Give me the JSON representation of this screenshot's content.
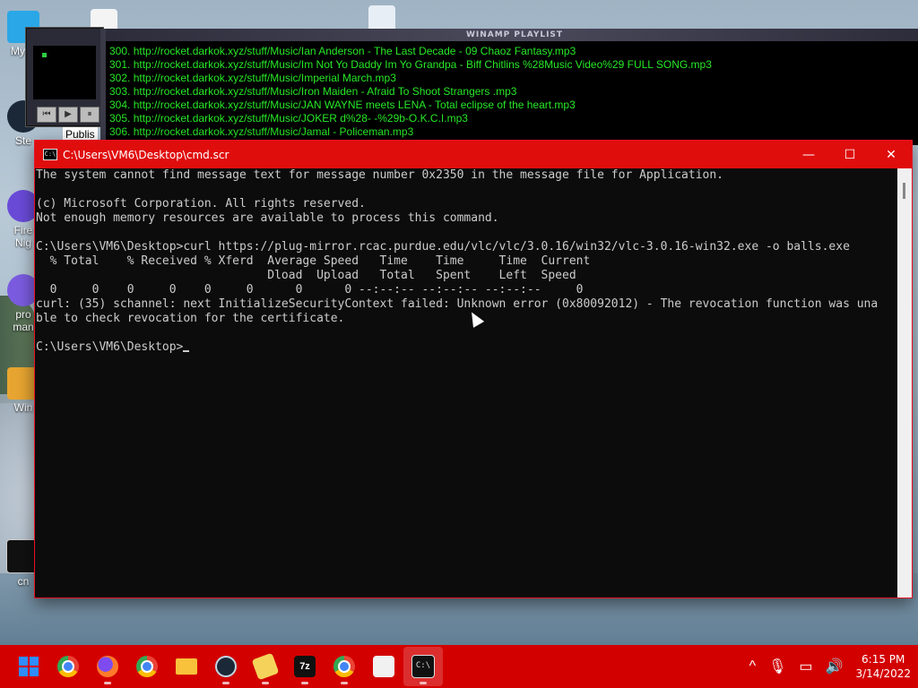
{
  "desktop": {
    "icons": [
      {
        "label": "My C"
      },
      {
        "label": "Ste"
      },
      {
        "label": "Fire\nNig"
      },
      {
        "label": "pro\nman"
      },
      {
        "label": "Win"
      },
      {
        "label": "cn"
      }
    ],
    "publis_label": "Publis"
  },
  "winamp": {
    "playlist_title": "WINAMP PLAYLIST",
    "tracks": [
      "300. http://rocket.darkok.xyz/stuff/Music/Ian Anderson - The Last Decade - 09 Chaoz Fantasy.mp3",
      "301. http://rocket.darkok.xyz/stuff/Music/Im Not Yo Daddy Im Yo Grandpa - Biff Chitlins %28Music Video%29 FULL SONG.mp3",
      "302. http://rocket.darkok.xyz/stuff/Music/Imperial March.mp3",
      "303. http://rocket.darkok.xyz/stuff/Music/Iron Maiden - Afraid To Shoot Strangers .mp3",
      "304. http://rocket.darkok.xyz/stuff/Music/JAN WAYNE meets LENA - Total eclipse of the heart.mp3",
      "305. http://rocket.darkok.xyz/stuff/Music/JOKER d%28- -%29b-O.K.C.I.mp3",
      "306. http://rocket.darkok.xyz/stuff/Music/Jamal - Policeman.mp3"
    ]
  },
  "cmd": {
    "title": "C:\\Users\\VM6\\Desktop\\cmd.scr",
    "icon_text": "C:\\",
    "lines": [
      "The system cannot find message text for message number 0x2350 in the message file for Application.",
      "",
      "(c) Microsoft Corporation. All rights reserved.",
      "Not enough memory resources are available to process this command.",
      "",
      "C:\\Users\\VM6\\Desktop>curl https://plug-mirror.rcac.purdue.edu/vlc/vlc/3.0.16/win32/vlc-3.0.16-win32.exe -o balls.exe",
      "  % Total    % Received % Xferd  Average Speed   Time    Time     Time  Current",
      "                                 Dload  Upload   Total   Spent    Left  Speed",
      "  0     0    0     0    0     0      0      0 --:--:-- --:--:-- --:--:--     0",
      "curl: (35) schannel: next InitializeSecurityContext failed: Unknown error (0x80092012) - The revocation function was una",
      "ble to check revocation for the certificate.",
      ""
    ],
    "prompt": "C:\\Users\\VM6\\Desktop>",
    "minimize_label": "—",
    "maximize_label": "☐",
    "close_label": "✕"
  },
  "taskbar": {
    "apps": [
      "start",
      "chrome",
      "firefox",
      "chrome",
      "file-explorer",
      "steam",
      "notepad",
      "7zip",
      "chrome",
      "package",
      "terminal"
    ],
    "clock_time": "6:15 PM",
    "clock_date": "3/14/2022",
    "tray_chevron": "^",
    "tray_mic": "🎙",
    "tray_display": "▭",
    "tray_volume": "🔊"
  }
}
